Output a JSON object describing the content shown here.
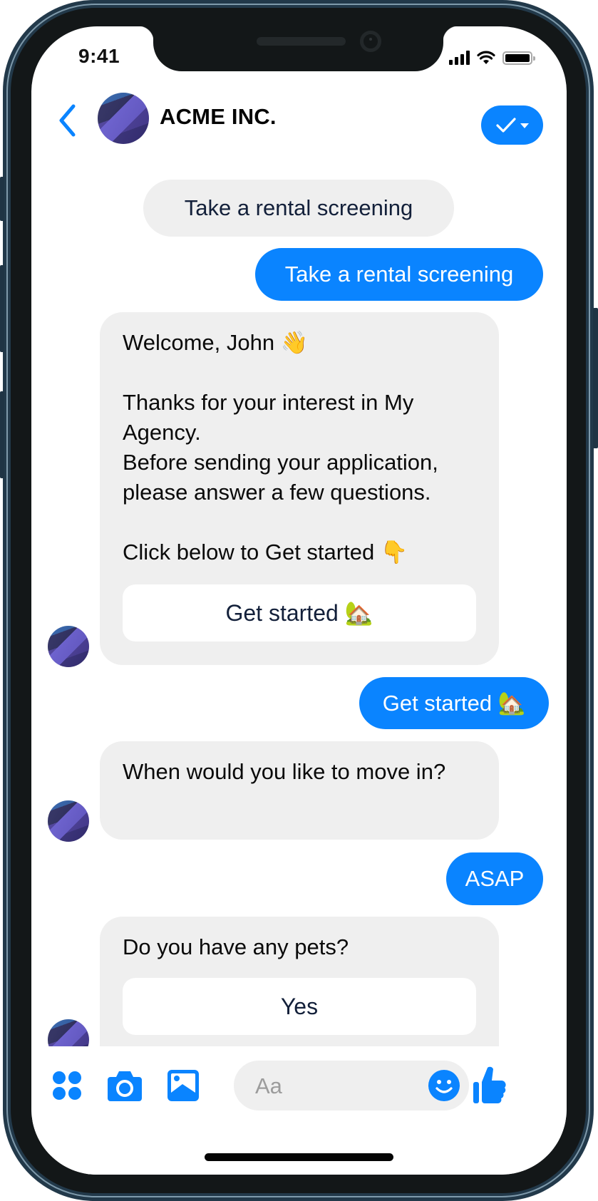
{
  "status_bar": {
    "time": "9:41",
    "icons": [
      "cellular-signal-icon",
      "wifi-icon",
      "battery-icon"
    ]
  },
  "header": {
    "back_icon": "chevron-left-icon",
    "avatar": "company-avatar",
    "title": "ACME INC.",
    "action_icons": [
      "checkmark-icon",
      "caret-down-icon"
    ]
  },
  "colors": {
    "accent": "#0a84ff",
    "incoming_bubble": "#efefef",
    "outgoing_text": "#ffffff",
    "incoming_text": "#0a0a0a",
    "button_text": "#13203a",
    "placeholder": "#9c9c9c"
  },
  "messages": [
    {
      "type": "system",
      "text": "Take a rental screening"
    },
    {
      "type": "outgoing",
      "text": "Take a rental screening"
    },
    {
      "type": "incoming",
      "text": "Welcome, John 👋\n\nThanks for your interest in My Agency.\nBefore sending your application, please answer a few questions.\n\nClick below to Get started 👇",
      "button": "Get started 🏡"
    },
    {
      "type": "outgoing",
      "text": "Get started 🏡"
    },
    {
      "type": "incoming",
      "text": "When would you like to move in?"
    },
    {
      "type": "outgoing",
      "text": "ASAP"
    },
    {
      "type": "incoming",
      "text": "Do you have any pets?",
      "button": "Yes"
    }
  ],
  "composer": {
    "placeholder": "Aa",
    "value": "",
    "left_icons": [
      "apps-grid-icon",
      "camera-icon",
      "gallery-icon"
    ],
    "emoji_icon": "emoji-icon",
    "send_icon": "thumbs-up-icon"
  }
}
